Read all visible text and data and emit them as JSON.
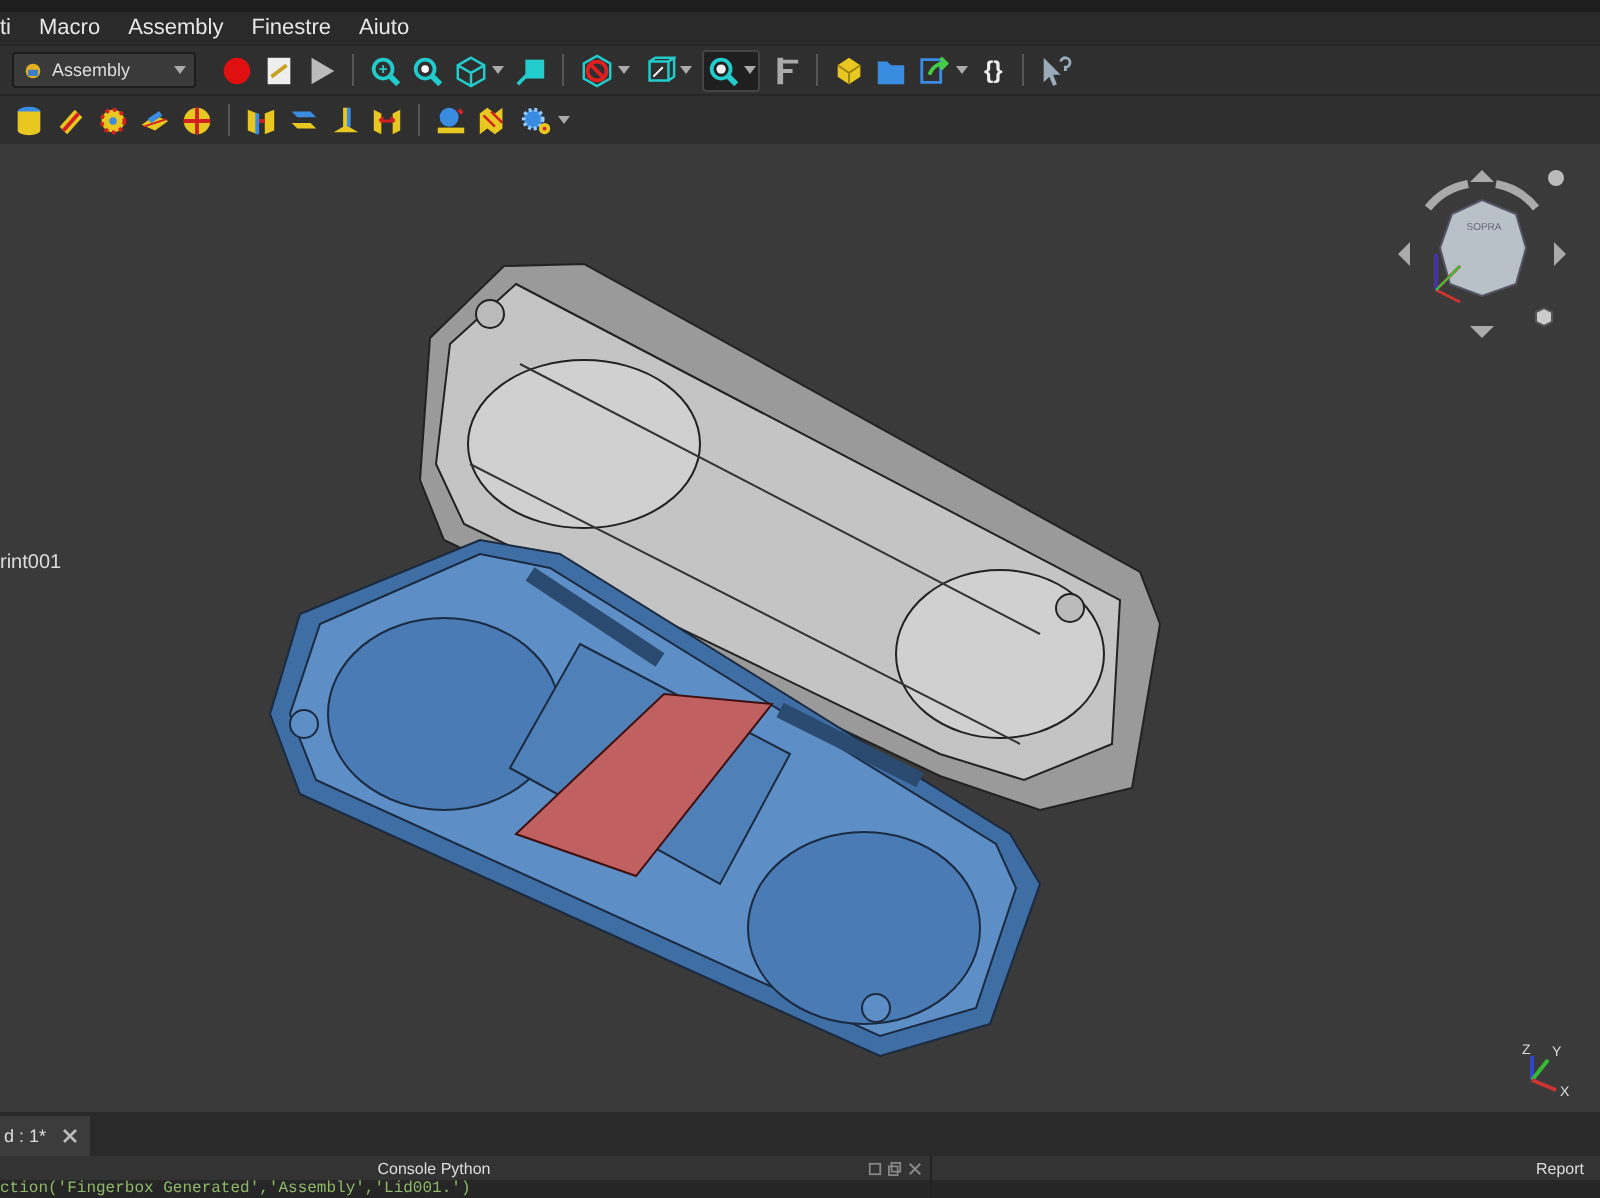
{
  "menu": [
    {
      "label": "ti"
    },
    {
      "label": "Macro"
    },
    {
      "label": "Assembly"
    },
    {
      "label": "Finestre"
    },
    {
      "label": "Aiuto"
    }
  ],
  "workbench": {
    "label": "Assembly"
  },
  "toolbar": {
    "braces": "{}",
    "zoom_pressed": true
  },
  "viewport": {
    "tree_label": "rint001",
    "nav_cube_face": "SOPRA",
    "axes": [
      "X",
      "Y",
      "Z"
    ]
  },
  "document_tabs": [
    {
      "label": "d : 1*",
      "selected": true
    }
  ],
  "console": {
    "title": "Console Python",
    "lines": [
      "ction('Fingerbox Generated','Assembly','Lid001.')"
    ]
  },
  "report": {
    "title": "Report"
  }
}
